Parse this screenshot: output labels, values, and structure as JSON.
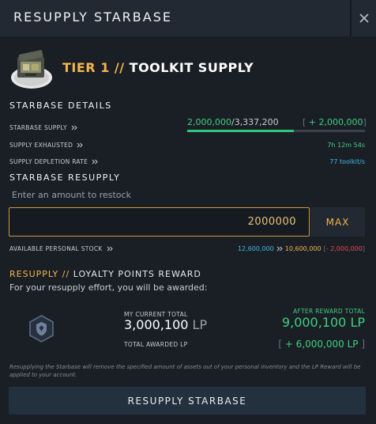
{
  "header": {
    "title": "RESUPPLY STARBASE"
  },
  "tier": {
    "prefix": "TIER 1 //",
    "name": "TOOLKIT SUPPLY"
  },
  "details": {
    "section_title": "STARBASE DETAILS",
    "supply": {
      "label": "STARBASE SUPPLY",
      "current": "2,000,000",
      "max": "/3,337,200",
      "add_open": "[ ",
      "add": "+ 2,000,000",
      "add_close": "]",
      "fill_fraction": 0.6
    },
    "exhausted": {
      "label": "SUPPLY EXHAUSTED",
      "value": "7h 12m 54s"
    },
    "depletion": {
      "label": "SUPPLY DEPLETION RATE",
      "value": "77 toolkit/s"
    }
  },
  "resupply": {
    "section_title": "STARBASE RESUPPLY",
    "hint": "Enter an amount to restock",
    "amount": "2000000",
    "max_label": "MAX"
  },
  "stock": {
    "label": "AVAILABLE PERSONAL STOCK",
    "current": "12,600,000",
    "after": "10,600,000",
    "change_open": "[",
    "change": "- 2,000,000",
    "change_close": "]"
  },
  "reward": {
    "title_prefix": "RESUPPLY //",
    "title": "LOYALTY POINTS REWARD",
    "subtitle": "For your resupply effort, you will be awarded:",
    "current_label": "MY CURRENT TOTAL",
    "current_value": "3,000,100",
    "lp_unit": "LP",
    "awarded_label": "TOTAL AWARDED LP",
    "after_label": "AFTER REWARD TOTAL",
    "after_value": "9,000,100 LP",
    "awarded_open": "[ ",
    "awarded_value": "+ 6,000,000 LP",
    "awarded_close": " ]"
  },
  "disclaimer": "Resupplying the Starbase will remove the specified amount of assets out of your personal inventory and the LP Reward will be applied to your account.",
  "action": {
    "button_label": "RESUPPLY STARBASE"
  },
  "colors": {
    "background": "#1a1f26",
    "header": "#232932",
    "accent_amber": "#f5b54a",
    "accent_green": "#3fcf7e",
    "accent_blue": "#44b8e6",
    "accent_red": "#e5484d",
    "button": "#23313f"
  },
  "icons": [
    "close-icon",
    "toolkit-crate-icon",
    "chevron-double-right-icon",
    "lp-shield-badge-icon"
  ]
}
